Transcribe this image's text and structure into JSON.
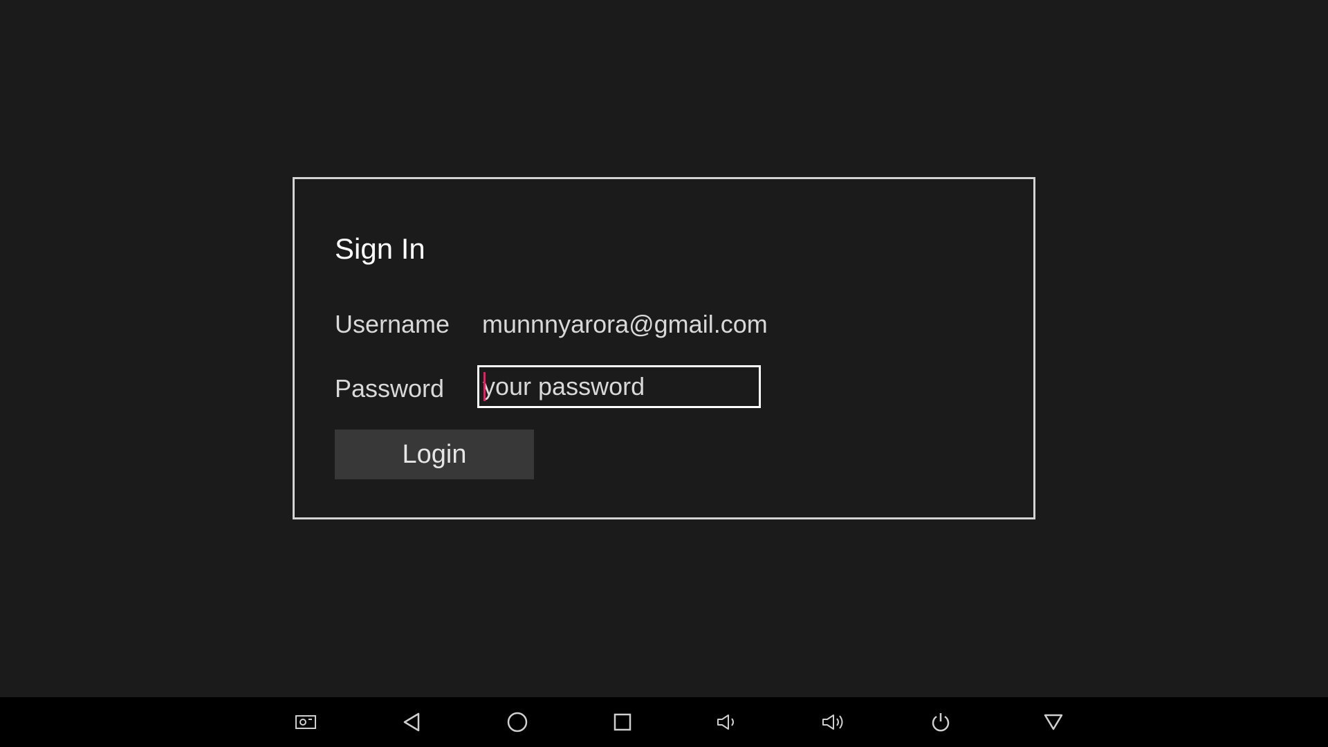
{
  "signin": {
    "title": "Sign In",
    "username_label": "Username",
    "username_value": "munnnyarora@gmail.com",
    "password_label": "Password",
    "password_placeholder": "your password",
    "password_value": "",
    "login_label": "Login"
  },
  "navbar": {
    "buttons": [
      {
        "icon": "screenshot-icon"
      },
      {
        "icon": "back-icon"
      },
      {
        "icon": "home-icon"
      },
      {
        "icon": "recents-icon"
      },
      {
        "icon": "volume-down-icon"
      },
      {
        "icon": "volume-up-icon"
      },
      {
        "icon": "power-icon"
      },
      {
        "icon": "hide-navbar-icon"
      }
    ]
  },
  "colors": {
    "background": "#1b1b1b",
    "navbar": "#000000",
    "panel_border": "#d4d4d4",
    "button_bg": "#383838",
    "caret": "#e91e63"
  }
}
